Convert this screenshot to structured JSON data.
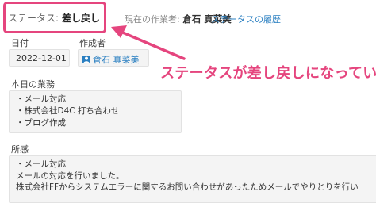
{
  "header": {
    "status_label": "ステータス: ",
    "status_value": "差し戻し",
    "current_worker_label": "現在の作業者: ",
    "current_worker_name": "倉石 真菜美",
    "history_link": "ステータスの履歴"
  },
  "callout": {
    "text": "ステータスが差し戻しになっている",
    "color": "#e5457e"
  },
  "report": {
    "date_label": "日付",
    "date_value": "2022-12-01",
    "author_label": "作成者",
    "author_icon": "user-avatar-icon",
    "author_name": "倉石 真菜美"
  },
  "business": {
    "label": "本日の業務",
    "items": [
      "・メール対応",
      "・株式会社D4C 打ち合わせ",
      "・ブログ作成"
    ]
  },
  "impressions": {
    "label": "所感",
    "lines": [
      "・メール対応",
      "メールの対応を行いました。",
      "株式会社FFからシステムエラーに関するお問い合わせがあったためメールでやりとりを行い"
    ]
  },
  "colors": {
    "accent": "#e5457e",
    "link": "#2a7fc1",
    "field_bg": "#f4f4f4"
  }
}
